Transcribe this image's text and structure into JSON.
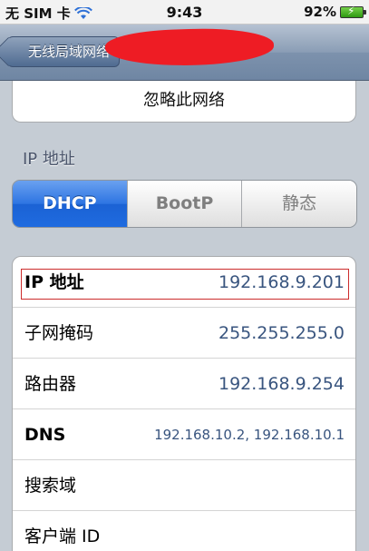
{
  "status_bar": {
    "carrier": "无 SIM 卡",
    "time": "9:43",
    "battery": "92%"
  },
  "nav": {
    "back_label": "无线局域网络"
  },
  "forget_button": "忽略此网络",
  "ip_section": {
    "title": "IP 地址",
    "segments": [
      "DHCP",
      "BootP",
      "静态"
    ],
    "selected": "DHCP"
  },
  "fields": [
    {
      "label": "IP 地址",
      "value": "192.168.9.201"
    },
    {
      "label": "子网掩码",
      "value": "255.255.255.0"
    },
    {
      "label": "路由器",
      "value": "192.168.9.254"
    },
    {
      "label": "DNS",
      "value": "192.168.10.2, 192.168.10.1"
    },
    {
      "label": "搜索域",
      "value": ""
    },
    {
      "label": "客户端 ID",
      "value": ""
    }
  ],
  "colors": {
    "nav_bar": "#7d92ad",
    "active_segment": "#2d74e2",
    "value_text": "#39557f",
    "highlight_box": "#cc2c2c",
    "redaction": "#ee1c24"
  }
}
